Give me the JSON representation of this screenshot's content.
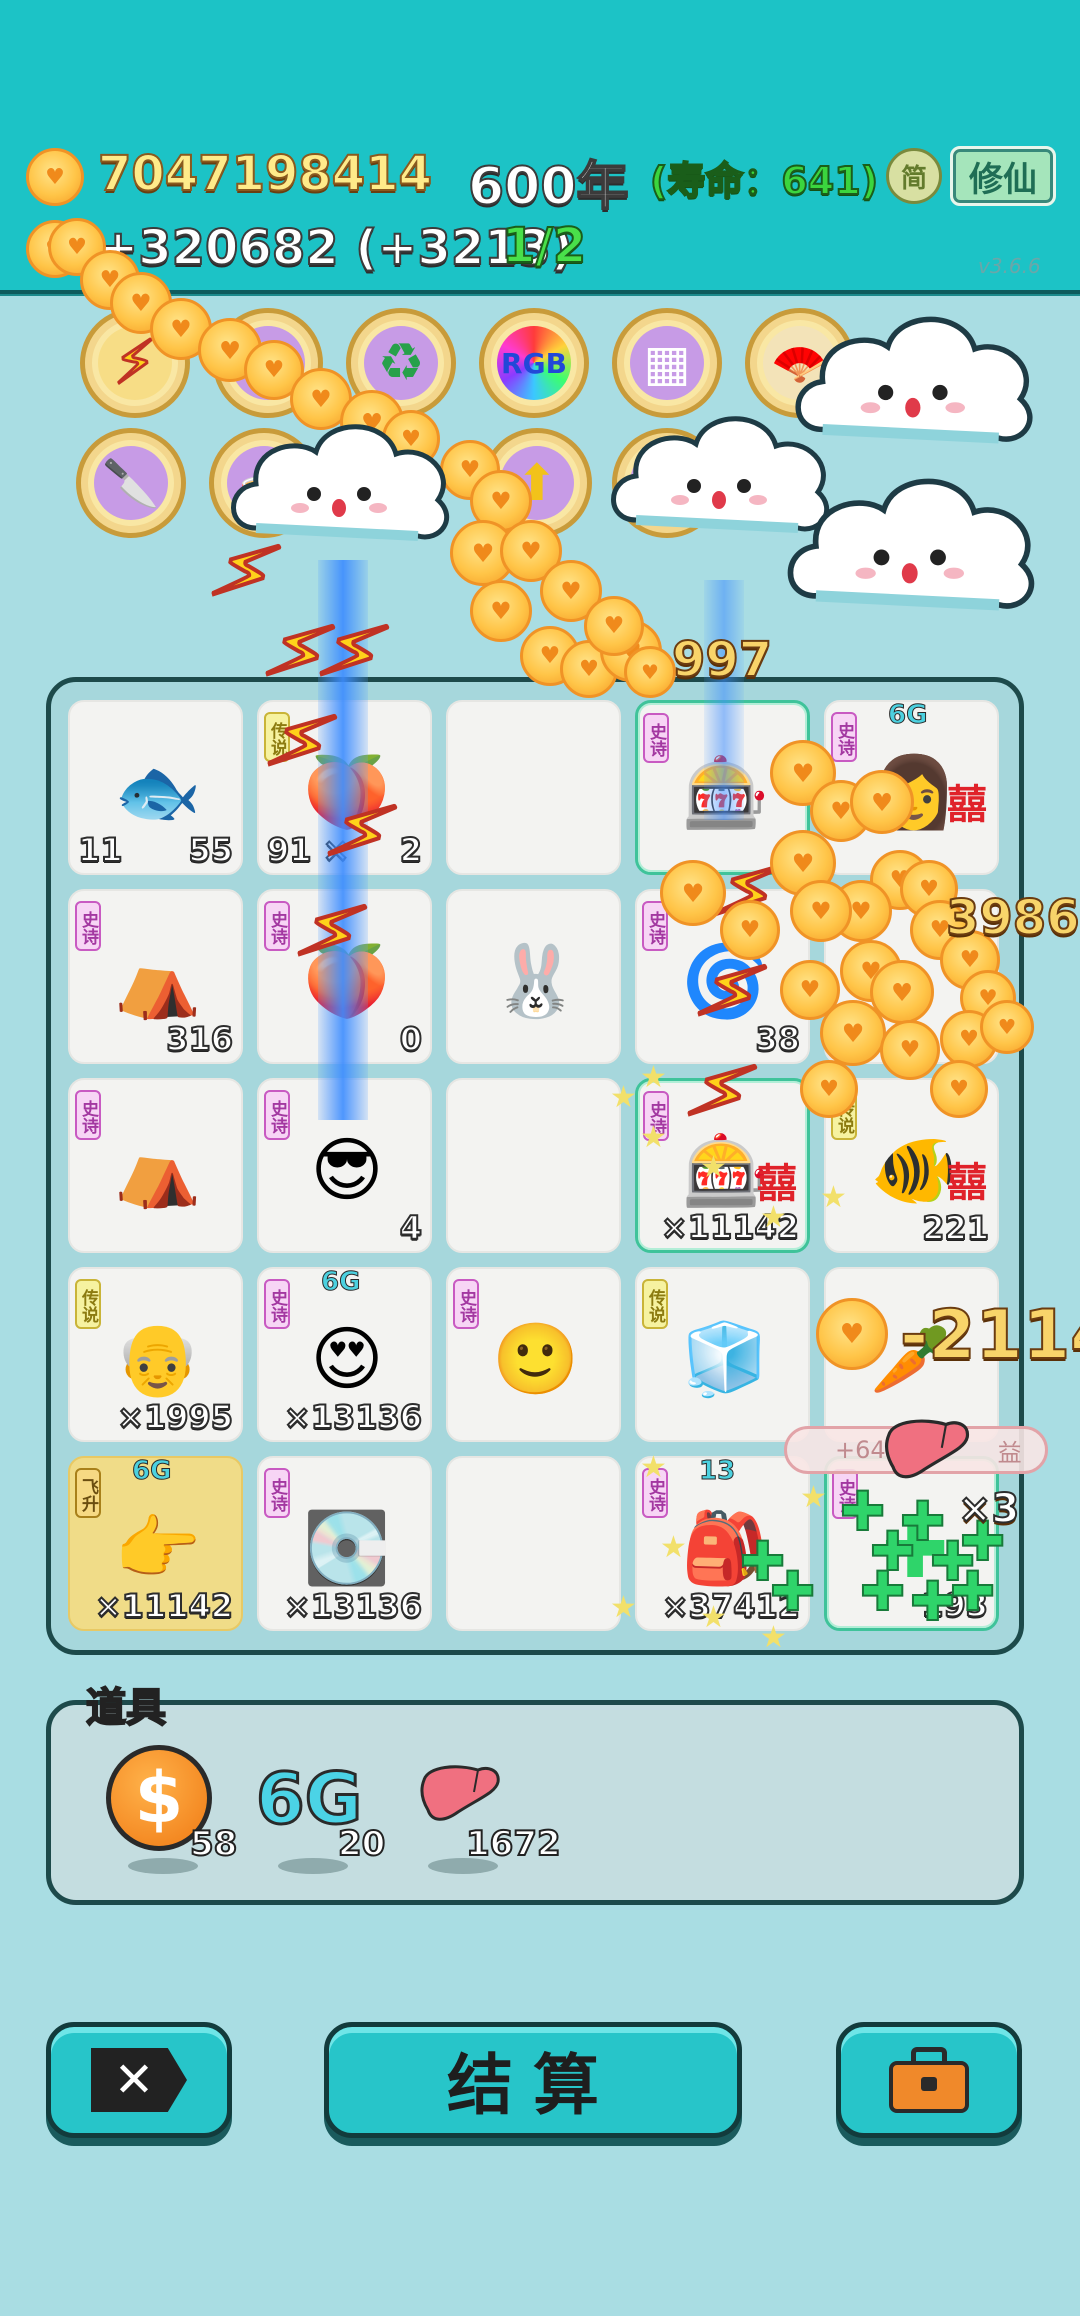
{
  "header": {
    "coins": "7047198414",
    "year": "600年",
    "lifespan": "(寿命：641)",
    "income": "+320682 (+3213)",
    "progress": "1/2",
    "simplify_label": "简",
    "cultivate_label": "修仙",
    "version": "v3.6.6"
  },
  "skills": {
    "row1": [
      "lightning-skill",
      "coin-stack-skill",
      "recycle-skill",
      "rgb-skill",
      "skirt-skill",
      "fan-skill"
    ],
    "row2": [
      "cleaver-skill",
      "bowl-skill",
      "upgrade-arrow-skill",
      "ice-bowls-skill",
      "cloud-skill",
      "cloud-skill-2"
    ],
    "rgb_label": "RGB"
  },
  "floating": {
    "coins_997": "997",
    "coins_3986": "3986",
    "damage": "-2114",
    "times3": "×3"
  },
  "board": {
    "cells": [
      {
        "row": 0,
        "col": 0,
        "icon": "fish-icon",
        "badge": "",
        "left_count": "11",
        "count": "55"
      },
      {
        "row": 0,
        "col": 1,
        "icon": "peach-icon",
        "badge": "传说",
        "left_count": "91 ×",
        "count": "2"
      },
      {
        "row": 0,
        "col": 2,
        "icon": "",
        "badge": "",
        "left_count": "",
        "count": ""
      },
      {
        "row": 0,
        "col": 3,
        "icon": "gacha-machine-icon",
        "badge": "史诗",
        "count": "",
        "tag": ""
      },
      {
        "row": 0,
        "col": 4,
        "icon": "girl-portrait-icon",
        "badge": "史诗",
        "count": "",
        "tag": "6G",
        "xi": "囍"
      },
      {
        "row": 1,
        "col": 0,
        "icon": "rabbit-tent-icon",
        "badge": "史诗",
        "count": "316"
      },
      {
        "row": 1,
        "col": 1,
        "icon": "peach-bun-icon",
        "badge": "史诗",
        "count": "0"
      },
      {
        "row": 1,
        "col": 2,
        "icon": "rabbit-figure-icon",
        "badge": "",
        "count": ""
      },
      {
        "row": 1,
        "col": 3,
        "icon": "gpu-fan-icon",
        "badge": "史诗",
        "count": "38"
      },
      {
        "row": 1,
        "col": 4,
        "icon": "",
        "badge": "",
        "count": ""
      },
      {
        "row": 2,
        "col": 0,
        "icon": "rabbit-tent-icon",
        "badge": "史诗",
        "count": ""
      },
      {
        "row": 2,
        "col": 1,
        "icon": "sunglasses-guy-icon",
        "badge": "史诗",
        "count": "4"
      },
      {
        "row": 2,
        "col": 2,
        "icon": "",
        "badge": "",
        "count": ""
      },
      {
        "row": 2,
        "col": 3,
        "icon": "gacha-machine-icon",
        "badge": "史诗",
        "count": "×11142",
        "xi": "囍"
      },
      {
        "row": 2,
        "col": 4,
        "icon": "koi-fish-icon",
        "badge": "传说",
        "count": "221",
        "xi": "囍"
      },
      {
        "row": 3,
        "col": 0,
        "icon": "old-man-icon",
        "badge": "传说",
        "count": "×1995"
      },
      {
        "row": 3,
        "col": 1,
        "icon": "heart-eyes-face-icon",
        "badge": "史诗",
        "count": "×13136",
        "tag": "6G"
      },
      {
        "row": 3,
        "col": 2,
        "icon": "smiley-face-icon",
        "badge": "史诗",
        "count": ""
      },
      {
        "row": 3,
        "col": 3,
        "icon": "fridge-icon",
        "badge": "传说",
        "count": ""
      },
      {
        "row": 3,
        "col": 4,
        "icon": "carrot-icon",
        "badge": "",
        "count": ""
      },
      {
        "row": 4,
        "col": 0,
        "icon": "pointing-hand-icon",
        "badge": "飞升",
        "count": "×11142",
        "tag": "6G"
      },
      {
        "row": 4,
        "col": 1,
        "icon": "graphics-card-icon",
        "badge": "史诗",
        "count": "×13136"
      },
      {
        "row": 4,
        "col": 2,
        "icon": "",
        "badge": "",
        "count": ""
      },
      {
        "row": 4,
        "col": 3,
        "icon": "golden-backpack-icon",
        "badge": "史诗",
        "count": "×37412",
        "tag": "13"
      },
      {
        "row": 4,
        "col": 4,
        "icon": "green-crosses-icon",
        "badge": "史诗",
        "count": "193"
      }
    ]
  },
  "toast": {
    "text": "+64",
    "suffix": "益"
  },
  "items": {
    "title": "道具",
    "list": [
      {
        "icon": "dollar-coin-icon",
        "count": "58"
      },
      {
        "icon": "6g-icon",
        "label": "6G",
        "count": "20"
      },
      {
        "icon": "liver-icon",
        "count": "1672"
      }
    ]
  },
  "buttons": {
    "close_icon": "close-tag-icon",
    "settle_label": "结算",
    "bag_icon": "briefcase-icon"
  },
  "colors": {
    "header_bg": "#1cc3c6",
    "page_bg": "#a9dde3",
    "button_bg": "#27c5c9",
    "board_border": "#1d4a4b"
  }
}
